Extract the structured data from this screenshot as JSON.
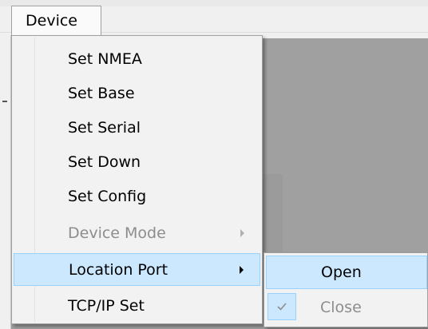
{
  "menubar": {
    "device_label": "Device"
  },
  "dropdown": {
    "items": [
      {
        "label": "Set NMEA"
      },
      {
        "label": "Set Base"
      },
      {
        "label": "Set Serial"
      },
      {
        "label": "Set Down"
      },
      {
        "label": "Set Config"
      },
      {
        "label": "Device Mode"
      },
      {
        "label": "Location Port"
      },
      {
        "label": "TCP/IP Set"
      }
    ]
  },
  "submenu": {
    "items": [
      {
        "label": "Open"
      },
      {
        "label": "Close"
      }
    ]
  },
  "icons": {
    "submenu_arrow": "chevron-right-icon",
    "check": "check-icon"
  },
  "colors": {
    "highlight_bg": "#cce8ff",
    "highlight_border": "#99d1ff",
    "disabled_text": "#8d8d8d",
    "canvas": "#a0a0a0"
  }
}
